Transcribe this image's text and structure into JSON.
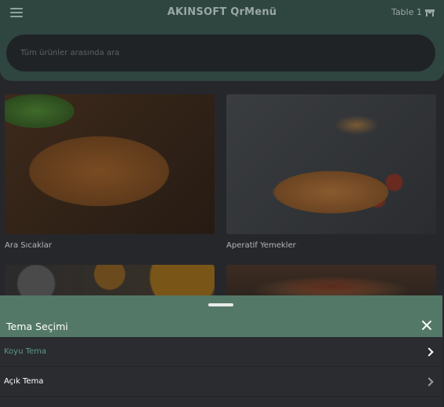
{
  "header": {
    "title": "AKINSOFT QrMenü",
    "table_label": "Table 1",
    "menu_icon": "hamburger-menu-icon",
    "table_icon": "table-icon"
  },
  "search": {
    "placeholder": "Tüm ürünler arasında ara"
  },
  "categories": [
    {
      "name": "Ara Sıcaklar"
    },
    {
      "name": "Aperatif Yemekler"
    },
    {
      "name": ""
    },
    {
      "name": ""
    }
  ],
  "theme_sheet": {
    "title": "Tema Seçimi",
    "options": [
      {
        "label": "Koyu Tema",
        "selected": true
      },
      {
        "label": "Açık Tema",
        "selected": false
      }
    ]
  },
  "colors": {
    "header_bg": "#2f4540",
    "sheet_bg": "#537868",
    "accent": "#5a9a8a",
    "page_bg": "#26272b"
  }
}
